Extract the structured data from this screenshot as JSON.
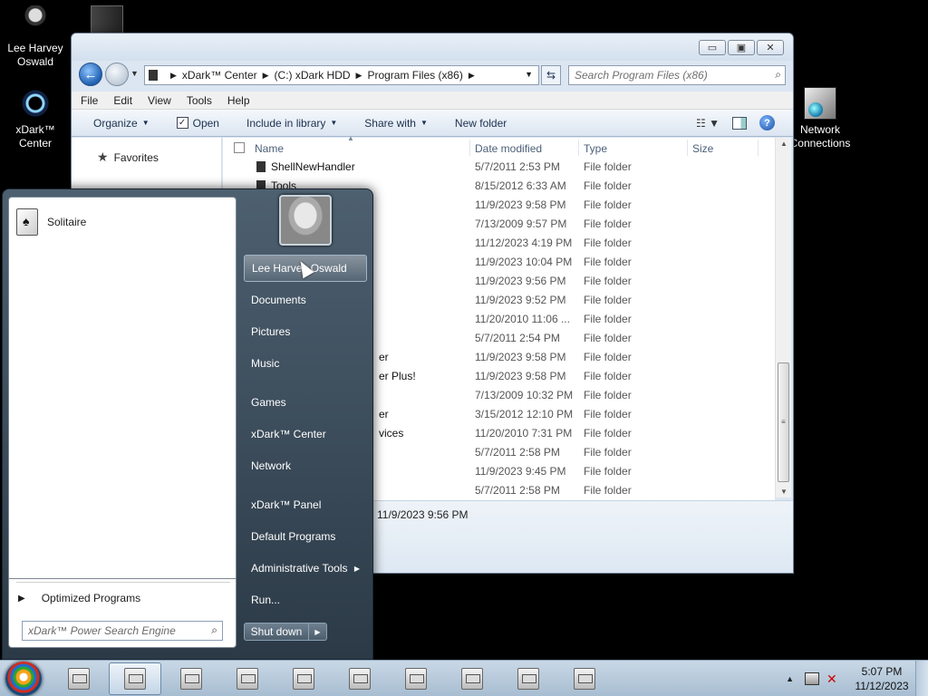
{
  "desktop": {
    "icons": [
      {
        "label": "Lee Harvey Oswald",
        "icon": "user-icon"
      },
      {
        "label": "xDark™ Center",
        "icon": "ring-icon"
      },
      {
        "label": "Network Connections",
        "icon": "network-icon"
      }
    ]
  },
  "explorer": {
    "address": {
      "crumbs": [
        "xDark™ Center",
        "(C:) xDark HDD",
        "Program Files (x86)"
      ]
    },
    "search_placeholder": "Search Program Files (x86)",
    "menu": [
      "File",
      "Edit",
      "View",
      "Tools",
      "Help"
    ],
    "toolbar": {
      "organize": "Organize",
      "open": "Open",
      "include": "Include in library",
      "share": "Share with",
      "new_folder": "New folder"
    },
    "nav": {
      "favorites": "Favorites"
    },
    "columns": {
      "name": "Name",
      "date": "Date modified",
      "type": "Type",
      "size": "Size"
    },
    "rows": [
      {
        "name": "ShellNewHandler",
        "date": "5/7/2011 2:53 PM",
        "type": "File folder"
      },
      {
        "name": "Tools",
        "date": "8/15/2012 6:33 AM",
        "type": "File folder"
      },
      {
        "name": "",
        "date": "11/9/2023 9:58 PM",
        "type": "File folder"
      },
      {
        "name": "",
        "date": "7/13/2009 9:57 PM",
        "type": "File folder"
      },
      {
        "name": "",
        "date": "11/12/2023 4:19 PM",
        "type": "File folder"
      },
      {
        "name": "",
        "date": "11/9/2023 10:04 PM",
        "type": "File folder"
      },
      {
        "name": "",
        "date": "11/9/2023 9:56 PM",
        "type": "File folder"
      },
      {
        "name": "",
        "date": "11/9/2023 9:52 PM",
        "type": "File folder"
      },
      {
        "name": "",
        "date": "11/20/2010 11:06 ...",
        "type": "File folder"
      },
      {
        "name": "",
        "date": "5/7/2011 2:54 PM",
        "type": "File folder"
      },
      {
        "name": "er",
        "date": "11/9/2023 9:58 PM",
        "type": "File folder"
      },
      {
        "name": "er Plus!",
        "date": "11/9/2023 9:58 PM",
        "type": "File folder"
      },
      {
        "name": "",
        "date": "7/13/2009 10:32 PM",
        "type": "File folder"
      },
      {
        "name": "er",
        "date": "3/15/2012 12:10 PM",
        "type": "File folder"
      },
      {
        "name": "vices",
        "date": "11/20/2010 7:31 PM",
        "type": "File folder"
      },
      {
        "name": "",
        "date": "5/7/2011 2:58 PM",
        "type": "File folder"
      },
      {
        "name": "",
        "date": "11/9/2023 9:45 PM",
        "type": "File folder"
      },
      {
        "name": "",
        "date": "5/7/2011 2:58 PM",
        "type": "File folder"
      }
    ],
    "details_date": "11/9/2023 9:56 PM"
  },
  "startmenu": {
    "pinned": [
      {
        "label": "Solitaire"
      }
    ],
    "all_programs": "Optimized Programs",
    "search_placeholder": "xDark™ Power Search Engine",
    "right": [
      {
        "label": "Lee Harvey Oswald"
      },
      {
        "label": "Documents"
      },
      {
        "label": "Pictures"
      },
      {
        "label": "Music"
      },
      {
        "label": "Games"
      },
      {
        "label": "xDark™ Center"
      },
      {
        "label": "Network"
      },
      {
        "label": "xDark™ Panel"
      },
      {
        "label": "Default Programs"
      },
      {
        "label": "Administrative Tools"
      },
      {
        "label": "Run..."
      }
    ],
    "shutdown": "Shut down"
  },
  "taskbar": {
    "time": "5:07 PM",
    "date": "11/12/2023"
  }
}
